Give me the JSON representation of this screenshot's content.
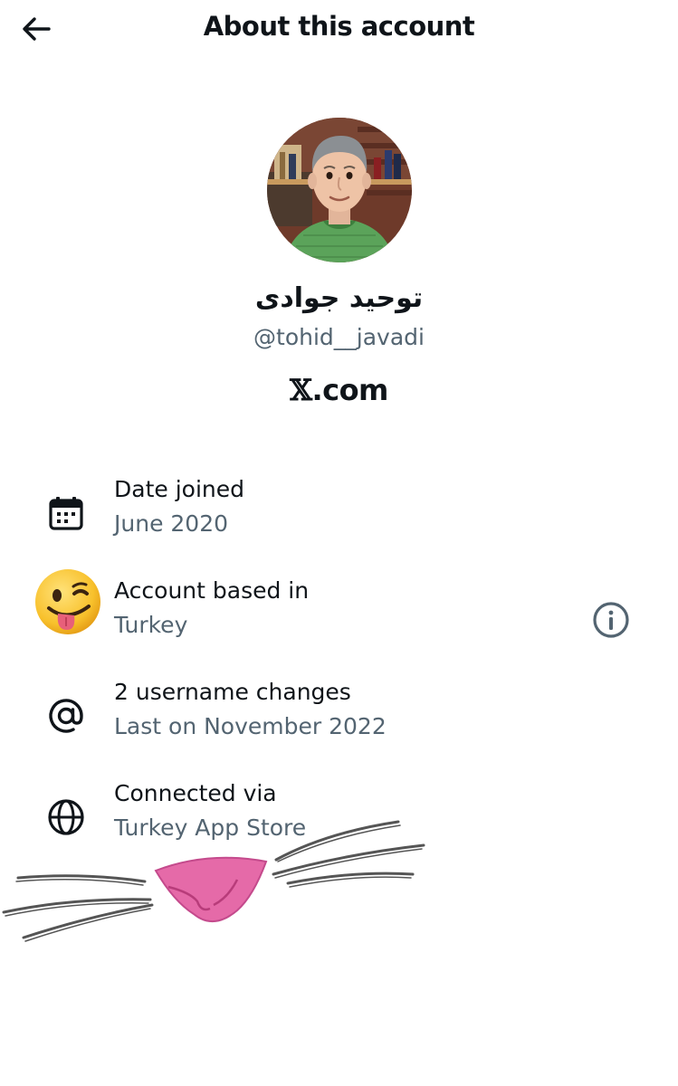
{
  "header": {
    "title": "About this account"
  },
  "profile": {
    "display_name": "توحید جوادی",
    "handle": "@tohid__javadi",
    "platform_prefix": "𝕏",
    "platform_suffix": ".com"
  },
  "details": [
    {
      "title": "Date joined",
      "value": "June 2020",
      "icon": "calendar-icon"
    },
    {
      "title": "Account based in",
      "value": "Turkey",
      "icon": "winking-tongue-emoji-icon"
    },
    {
      "title": "2 username changes",
      "value": "Last on November 2022",
      "icon": "at-sign-icon"
    },
    {
      "title": "Connected via",
      "value": "Turkey App Store",
      "icon": "globe-icon"
    }
  ],
  "colors": {
    "text_primary": "#0f1419",
    "text_secondary": "#536471",
    "background": "#ffffff",
    "nose_pink": "#e56aa8"
  }
}
